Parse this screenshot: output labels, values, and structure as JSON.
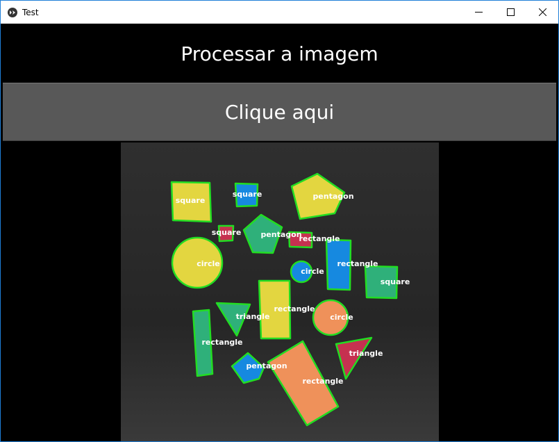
{
  "window": {
    "title": "Test",
    "accent": "#1f7fd8"
  },
  "icons": {
    "app": "kivy-logo-icon",
    "minimize": "minimize-icon",
    "maximize": "maximize-icon",
    "close": "close-icon"
  },
  "heading": "Processar a imagem",
  "button_label": "Clique aqui",
  "image": {
    "contour_color": "#22dd22",
    "label_color": "#ffffff",
    "shapes": [
      {
        "label": "square",
        "fill": "#e3d640"
      },
      {
        "label": "square",
        "fill": "#1689e0"
      },
      {
        "label": "pentagon",
        "fill": "#e3d640"
      },
      {
        "label": "square",
        "fill": "#c63150"
      },
      {
        "label": "pentagon",
        "fill": "#2fb07a"
      },
      {
        "label": "rectangle",
        "fill": "#c63150"
      },
      {
        "label": "circle",
        "fill": "#e3d640"
      },
      {
        "label": "circle",
        "fill": "#1689e0"
      },
      {
        "label": "rectangle",
        "fill": "#1689e0"
      },
      {
        "label": "square",
        "fill": "#2fb07a"
      },
      {
        "label": "rectangle",
        "fill": "#e3d640"
      },
      {
        "label": "triangle",
        "fill": "#2fb07a"
      },
      {
        "label": "circle",
        "fill": "#ef915a"
      },
      {
        "label": "rectangle",
        "fill": "#2fb07a"
      },
      {
        "label": "triangle",
        "fill": "#c63150"
      },
      {
        "label": "pentagon",
        "fill": "#1689e0"
      },
      {
        "label": "rectangle",
        "fill": "#ef915a"
      }
    ]
  }
}
